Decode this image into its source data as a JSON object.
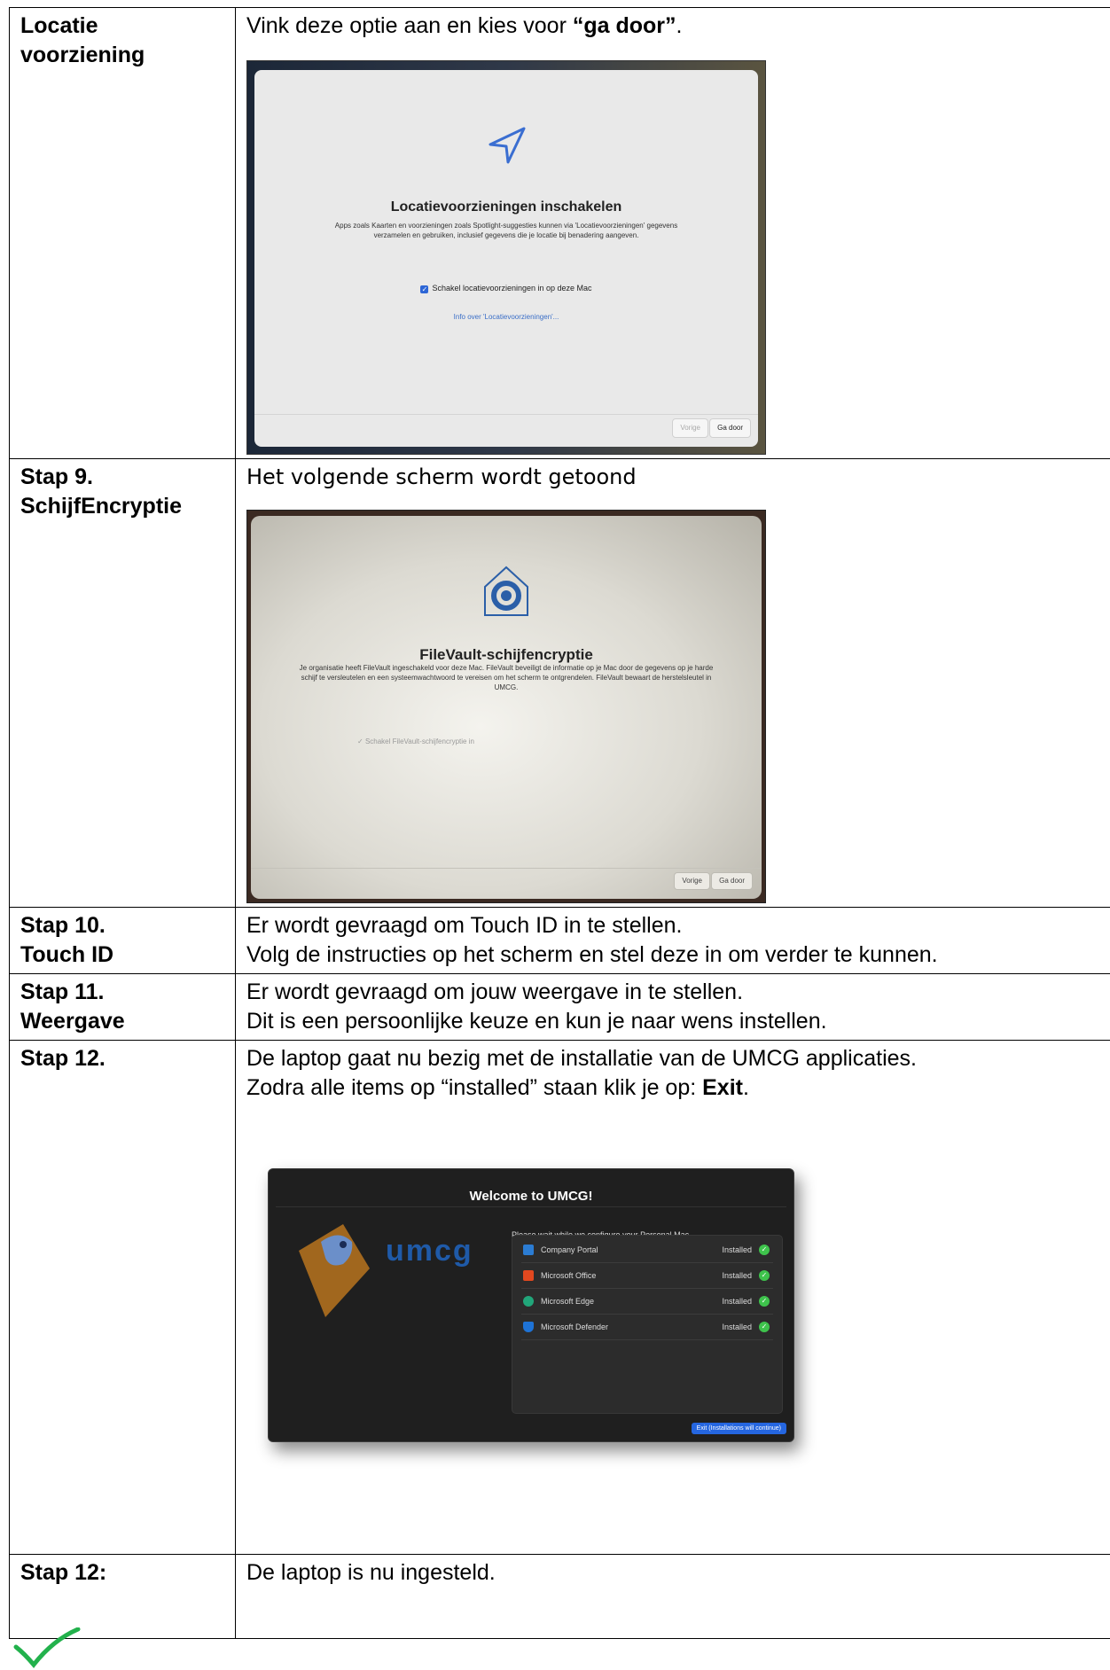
{
  "rows": [
    {
      "label_lines": [
        "Locatie",
        "voorziening"
      ],
      "text_pre": "Vink deze optie aan en kies voor ",
      "text_bold": "“ga door”",
      "text_post": "."
    },
    {
      "label_lines": [
        "Stap 9.",
        "SchijfEncryptie"
      ],
      "text": "Het volgende scherm wordt getoond"
    },
    {
      "label_lines": [
        "Stap 10.",
        "Touch ID"
      ],
      "text_lines": [
        "Er wordt gevraagd om Touch ID in te stellen.",
        "Volg de instructies op het scherm en stel deze in om verder te kunnen."
      ]
    },
    {
      "label_lines": [
        "Stap 11.",
        "Weergave"
      ],
      "text_lines": [
        "Er wordt gevraagd om jouw weergave in te stellen.",
        "Dit is een persoonlijke keuze en kun je naar wens instellen."
      ]
    },
    {
      "label_lines": [
        "Stap 12."
      ],
      "line1": "De laptop gaat nu bezig met de installatie van de UMCG applicaties.",
      "line2_pre": "Zodra alle items op “installed” staan klik je op: ",
      "line2_bold": "Exit",
      "line2_post": "."
    },
    {
      "label_lines": [
        "Stap 12:"
      ],
      "text": "De laptop is nu ingesteld."
    }
  ],
  "screen_location": {
    "title": "Locatievoorzieningen inschakelen",
    "desc": "Apps zoals Kaarten en voorzieningen zoals Spotlight-suggesties kunnen via 'Locatievoorzieningen' gegevens verzamelen en gebruiken, inclusief gegevens die je locatie bij benadering aangeven.",
    "checkbox": "Schakel locatievoorzieningen in op deze Mac",
    "link": "Info over 'Locatievoorzieningen'...",
    "back": "Vorige",
    "next": "Ga door",
    "icon": "location-arrow-icon"
  },
  "screen_filevault": {
    "title": "FileVault-schijfencryptie",
    "desc": "Je organisatie heeft FileVault ingeschakeld voor deze Mac. FileVault beveiligt de informatie op je Mac door de gegevens op je harde schijf te versleutelen en een systeemwachtwoord te vereisen om het scherm te ontgrendelen. FileVault bewaart de herstelsleutel in UMCG.",
    "checkbox": "Schakel FileVault-schijfencryptie in",
    "back": "Vorige",
    "next": "Ga door",
    "icon": "filevault-house-icon"
  },
  "screen_umcg": {
    "title": "Welcome to UMCG!",
    "logo_text": "umcg",
    "wait": "Please wait while we configure your Personal Mac...",
    "items": [
      {
        "name": "Company Portal",
        "status": "Installed",
        "color": "#2b7cd3"
      },
      {
        "name": "Microsoft Office",
        "status": "Installed",
        "color": "#e2481f"
      },
      {
        "name": "Microsoft Edge",
        "status": "Installed",
        "color": "#21a67a"
      },
      {
        "name": "Microsoft Defender",
        "status": "Installed",
        "color": "#1e73d6"
      }
    ],
    "exit": "Exit (Installations will continue)"
  },
  "colors": {
    "check": "#22b14c",
    "umcg_blue": "#1f5aa8",
    "installed_ok": "#3ec34c"
  }
}
